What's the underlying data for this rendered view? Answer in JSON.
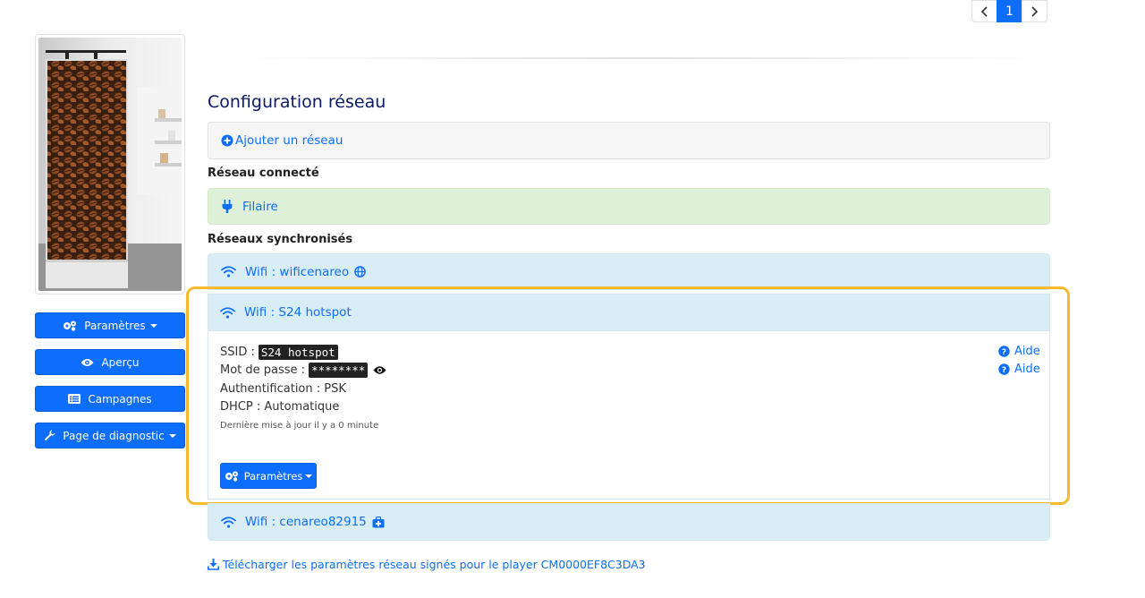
{
  "pagination": {
    "current": "1",
    "prev_icon": "chevron-left",
    "next_icon": "chevron-right"
  },
  "sidebar": {
    "buttons": [
      {
        "label": "Paramètres",
        "icon": "gears-icon",
        "dropdown": true
      },
      {
        "label": "Aperçu",
        "icon": "eye-icon",
        "dropdown": false
      },
      {
        "label": "Campagnes",
        "icon": "list-icon",
        "dropdown": false
      },
      {
        "label": "Page de diagnostic",
        "icon": "wrench-icon",
        "dropdown": true
      }
    ]
  },
  "main": {
    "title": "Configuration réseau",
    "add_network": "Ajouter un réseau",
    "connected_label": "Réseau connecté",
    "connected": {
      "label": "Filaire",
      "icon": "plug-icon"
    },
    "synced_label": "Réseaux synchronisés",
    "networks": [
      {
        "label": "Wifi : wificenareo",
        "icon": "wifi-icon",
        "extra_icon": "globe-icon"
      },
      {
        "label": "Wifi : S24 hotspot",
        "icon": "wifi-icon",
        "expanded": true
      },
      {
        "label": "Wifi : cenareo82915",
        "icon": "wifi-icon",
        "extra_icon": "medkit-icon"
      }
    ],
    "details": {
      "ssid_label": "SSID :",
      "ssid_value": "S24 hotspot",
      "password_label": "Mot de passe :",
      "password_value": "********",
      "auth": "Authentification : PSK",
      "dhcp": "DHCP : Automatique",
      "updated": "Dernière mise à jour il y a 0 minute",
      "help_label": "Aide",
      "params_button": "Paramètres"
    },
    "download_link": "Télécharger les paramètres réseau signés pour le player CM0000EF8C3DA3"
  },
  "colors": {
    "primary": "#0d6efd",
    "highlight": "#f7b92d",
    "info_bg": "#d9edf7",
    "success_bg": "#dff0d8"
  }
}
